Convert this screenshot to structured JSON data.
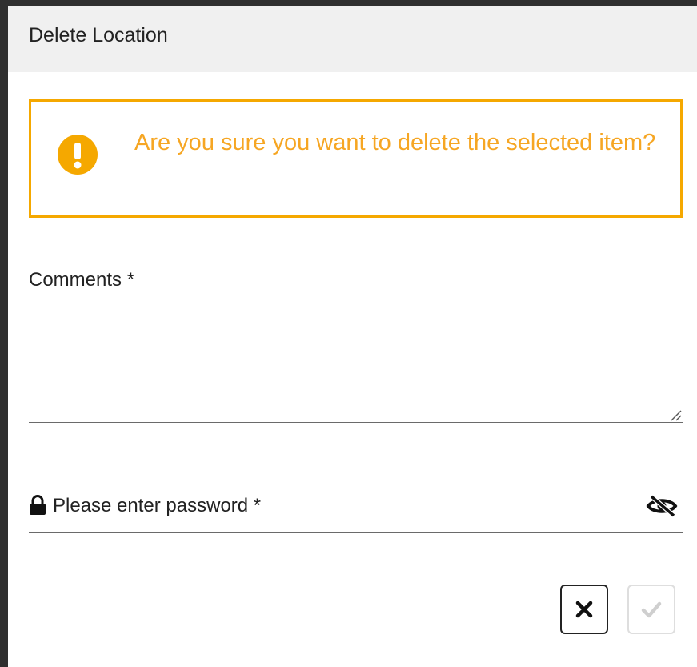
{
  "dialog": {
    "title": "Delete Location",
    "warning": {
      "icon": "exclamation-circle-icon",
      "message": "Are you sure you want to delete the selected item?",
      "color": "#f5a800"
    },
    "comments": {
      "label": "Comments *",
      "value": ""
    },
    "password": {
      "placeholder": "Please enter password *",
      "value": "",
      "lock_icon": "lock-icon",
      "toggle_icon": "eye-slash-icon"
    },
    "actions": {
      "cancel_icon": "close-icon",
      "confirm_icon": "check-icon",
      "confirm_enabled": false
    }
  }
}
